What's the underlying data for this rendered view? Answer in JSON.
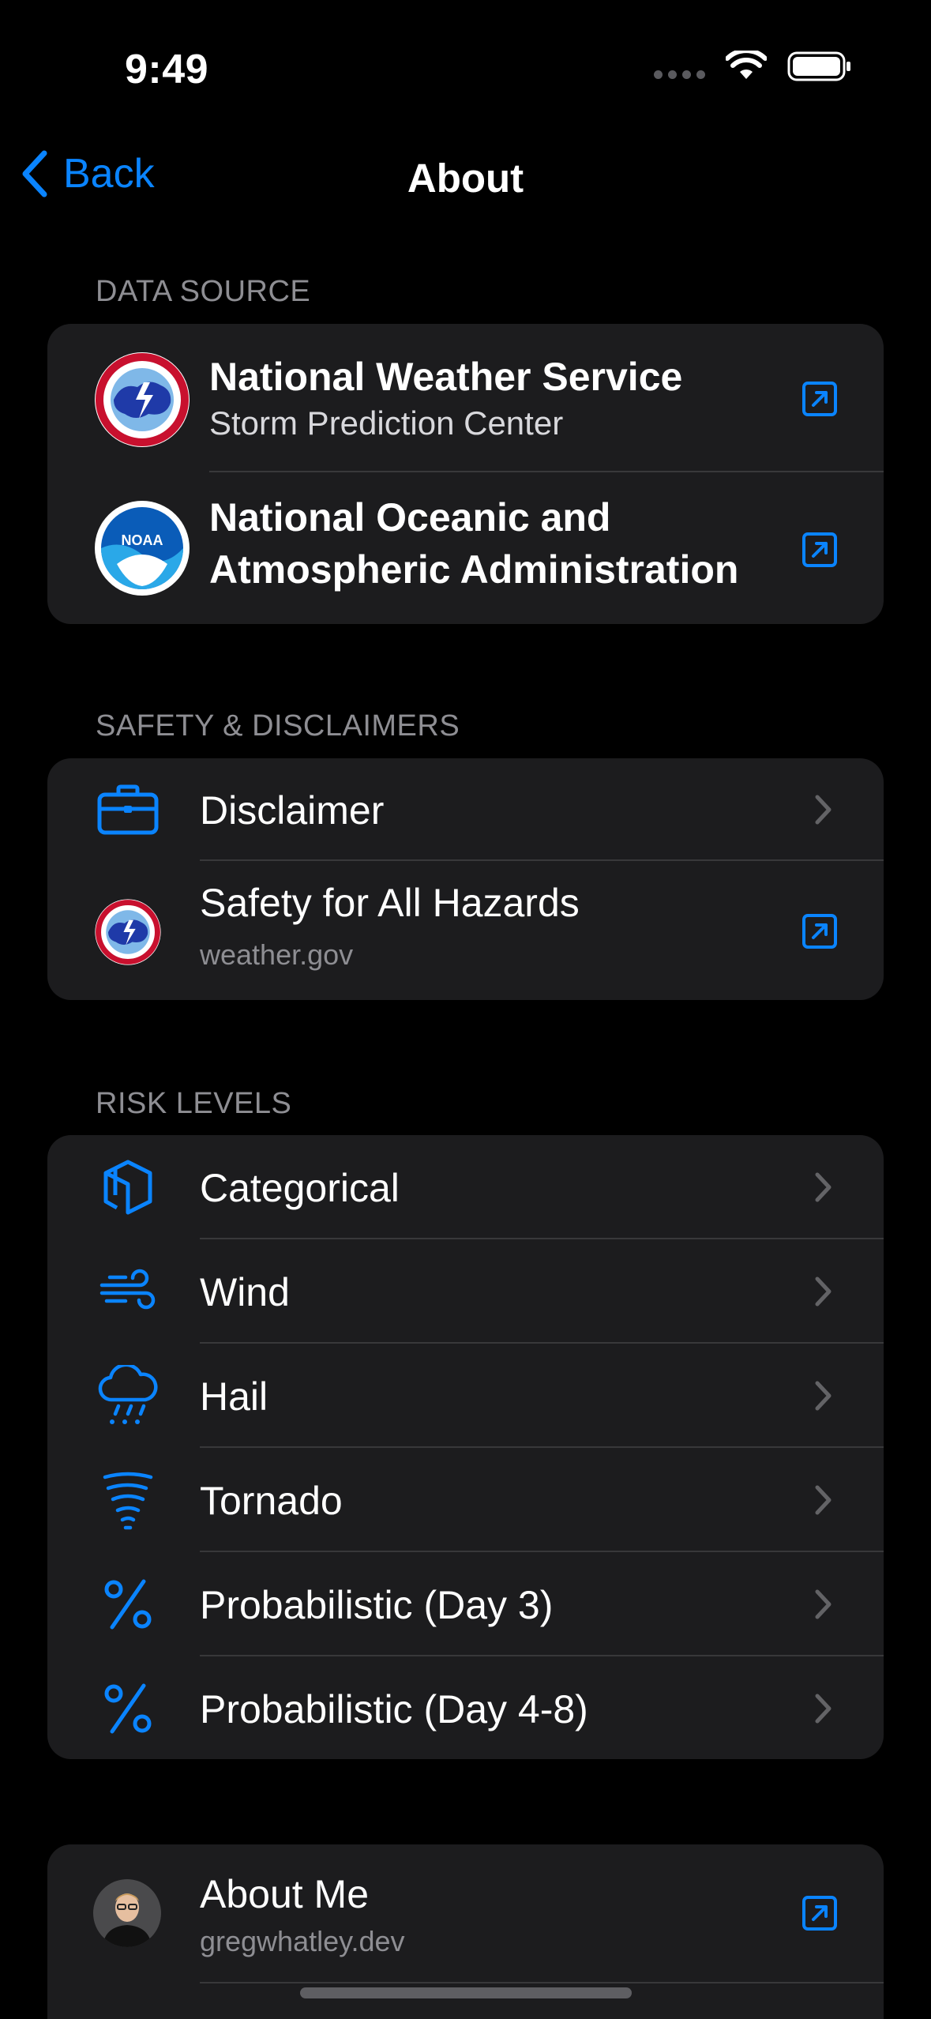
{
  "status": {
    "time": "9:49"
  },
  "nav": {
    "back_label": "Back",
    "title": "About"
  },
  "sections": {
    "data_source": {
      "header": "DATA SOURCE",
      "items": [
        {
          "title": "National Weather Service",
          "subtitle": "Storm Prediction Center",
          "icon": "nws-logo",
          "accessory": "external-link-icon"
        },
        {
          "title_line1": "National Oceanic and",
          "title_line2": "Atmospheric Administration",
          "icon": "noaa-logo",
          "accessory": "external-link-icon"
        }
      ]
    },
    "safety": {
      "header": "SAFETY & DISCLAIMERS",
      "items": [
        {
          "title": "Disclaimer",
          "icon": "briefcase-icon",
          "accessory": "chevron-right-icon"
        },
        {
          "title": "Safety for All Hazards",
          "subtitle": "weather.gov",
          "icon": "nws-logo",
          "accessory": "external-link-icon"
        }
      ]
    },
    "risk_levels": {
      "header": "RISK LEVELS",
      "items": [
        {
          "title": "Categorical",
          "icon": "layered-squares-icon"
        },
        {
          "title": "Wind",
          "icon": "wind-icon"
        },
        {
          "title": "Hail",
          "icon": "cloud-hail-icon"
        },
        {
          "title": "Tornado",
          "icon": "tornado-icon"
        },
        {
          "title": "Probabilistic (Day 3)",
          "icon": "percent-icon"
        },
        {
          "title": "Probabilistic (Day 4-8)",
          "icon": "percent-icon"
        }
      ]
    },
    "about": {
      "items": [
        {
          "title": "About Me",
          "subtitle": "gregwhatley.dev",
          "icon": "avatar",
          "accessory": "external-link-icon"
        }
      ]
    }
  },
  "colors": {
    "accent": "#0a84ff",
    "background": "#000000",
    "card": "#1c1c1e",
    "secondary_text": "#8e8e93"
  }
}
